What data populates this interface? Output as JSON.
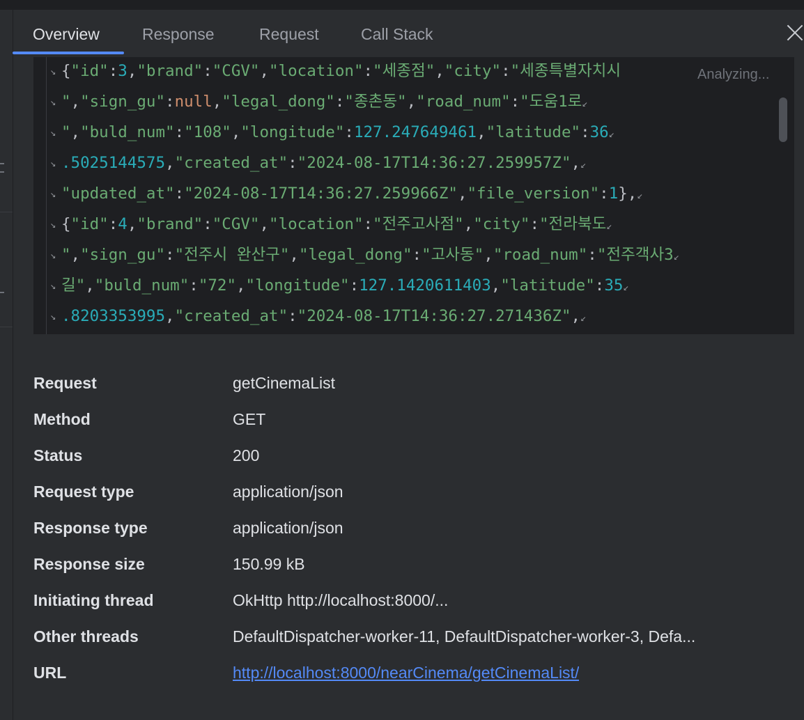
{
  "tabs": [
    {
      "label": "Overview",
      "active": true
    },
    {
      "label": "Response",
      "active": false
    },
    {
      "label": "Request",
      "active": false
    },
    {
      "label": "Call Stack",
      "active": false
    }
  ],
  "status_hint": "Analyzing...",
  "code": {
    "lines": [
      [
        {
          "t": "p",
          "v": "{"
        },
        {
          "t": "s",
          "v": "\"id\""
        },
        {
          "t": "p",
          "v": ":"
        },
        {
          "t": "n",
          "v": "3"
        },
        {
          "t": "p",
          "v": ","
        },
        {
          "t": "s",
          "v": "\"brand\""
        },
        {
          "t": "p",
          "v": ":"
        },
        {
          "t": "s",
          "v": "\"CGV\""
        },
        {
          "t": "p",
          "v": ","
        },
        {
          "t": "s",
          "v": "\"location\""
        },
        {
          "t": "p",
          "v": ":"
        },
        {
          "t": "s",
          "v": "\"세종점\""
        },
        {
          "t": "p",
          "v": ","
        },
        {
          "t": "s",
          "v": "\"city\""
        },
        {
          "t": "p",
          "v": ":"
        },
        {
          "t": "s",
          "v": "\"세종특별자치시"
        }
      ],
      [
        {
          "t": "s",
          "v": "\""
        },
        {
          "t": "p",
          "v": ","
        },
        {
          "t": "s",
          "v": "\"sign_gu\""
        },
        {
          "t": "p",
          "v": ":"
        },
        {
          "t": "k",
          "v": "null"
        },
        {
          "t": "p",
          "v": ","
        },
        {
          "t": "s",
          "v": "\"legal_dong\""
        },
        {
          "t": "p",
          "v": ":"
        },
        {
          "t": "s",
          "v": "\"종촌동\""
        },
        {
          "t": "p",
          "v": ","
        },
        {
          "t": "s",
          "v": "\"road_num\""
        },
        {
          "t": "p",
          "v": ":"
        },
        {
          "t": "s",
          "v": "\"도움1로"
        }
      ],
      [
        {
          "t": "s",
          "v": "\""
        },
        {
          "t": "p",
          "v": ","
        },
        {
          "t": "s",
          "v": "\"buld_num\""
        },
        {
          "t": "p",
          "v": ":"
        },
        {
          "t": "s",
          "v": "\"108\""
        },
        {
          "t": "p",
          "v": ","
        },
        {
          "t": "s",
          "v": "\"longitude\""
        },
        {
          "t": "p",
          "v": ":"
        },
        {
          "t": "n",
          "v": "127.247649461"
        },
        {
          "t": "p",
          "v": ","
        },
        {
          "t": "s",
          "v": "\"latitude\""
        },
        {
          "t": "p",
          "v": ":"
        },
        {
          "t": "n",
          "v": "36"
        }
      ],
      [
        {
          "t": "n",
          "v": ".5025144575"
        },
        {
          "t": "p",
          "v": ","
        },
        {
          "t": "s",
          "v": "\"created_at\""
        },
        {
          "t": "p",
          "v": ":"
        },
        {
          "t": "s",
          "v": "\"2024-08-17T14:36:27.259957Z\""
        },
        {
          "t": "p",
          "v": ","
        }
      ],
      [
        {
          "t": "s",
          "v": "\"updated_at\""
        },
        {
          "t": "p",
          "v": ":"
        },
        {
          "t": "s",
          "v": "\"2024-08-17T14:36:27.259966Z\""
        },
        {
          "t": "p",
          "v": ","
        },
        {
          "t": "s",
          "v": "\"file_version\""
        },
        {
          "t": "p",
          "v": ":"
        },
        {
          "t": "n",
          "v": "1"
        },
        {
          "t": "p",
          "v": "},"
        }
      ],
      [
        {
          "t": "p",
          "v": "{"
        },
        {
          "t": "s",
          "v": "\"id\""
        },
        {
          "t": "p",
          "v": ":"
        },
        {
          "t": "n",
          "v": "4"
        },
        {
          "t": "p",
          "v": ","
        },
        {
          "t": "s",
          "v": "\"brand\""
        },
        {
          "t": "p",
          "v": ":"
        },
        {
          "t": "s",
          "v": "\"CGV\""
        },
        {
          "t": "p",
          "v": ","
        },
        {
          "t": "s",
          "v": "\"location\""
        },
        {
          "t": "p",
          "v": ":"
        },
        {
          "t": "s",
          "v": "\"전주고사점\""
        },
        {
          "t": "p",
          "v": ","
        },
        {
          "t": "s",
          "v": "\"city\""
        },
        {
          "t": "p",
          "v": ":"
        },
        {
          "t": "s",
          "v": "\"전라북도"
        }
      ],
      [
        {
          "t": "s",
          "v": "\""
        },
        {
          "t": "p",
          "v": ","
        },
        {
          "t": "s",
          "v": "\"sign_gu\""
        },
        {
          "t": "p",
          "v": ":"
        },
        {
          "t": "s",
          "v": "\"전주시 완산구\""
        },
        {
          "t": "p",
          "v": ","
        },
        {
          "t": "s",
          "v": "\"legal_dong\""
        },
        {
          "t": "p",
          "v": ":"
        },
        {
          "t": "s",
          "v": "\"고사동\""
        },
        {
          "t": "p",
          "v": ","
        },
        {
          "t": "s",
          "v": "\"road_num\""
        },
        {
          "t": "p",
          "v": ":"
        },
        {
          "t": "s",
          "v": "\"전주객사3"
        }
      ],
      [
        {
          "t": "s",
          "v": "길\""
        },
        {
          "t": "p",
          "v": ","
        },
        {
          "t": "s",
          "v": "\"buld_num\""
        },
        {
          "t": "p",
          "v": ":"
        },
        {
          "t": "s",
          "v": "\"72\""
        },
        {
          "t": "p",
          "v": ","
        },
        {
          "t": "s",
          "v": "\"longitude\""
        },
        {
          "t": "p",
          "v": ":"
        },
        {
          "t": "n",
          "v": "127.1420611403"
        },
        {
          "t": "p",
          "v": ","
        },
        {
          "t": "s",
          "v": "\"latitude\""
        },
        {
          "t": "p",
          "v": ":"
        },
        {
          "t": "n",
          "v": "35"
        }
      ],
      [
        {
          "t": "n",
          "v": ".8203353995"
        },
        {
          "t": "p",
          "v": ","
        },
        {
          "t": "s",
          "v": "\"created_at\""
        },
        {
          "t": "p",
          "v": ":"
        },
        {
          "t": "s",
          "v": "\"2024-08-17T14:36:27.271436Z\""
        },
        {
          "t": "p",
          "v": ","
        }
      ]
    ],
    "colors": {
      "string": "#6aab73",
      "number": "#2aacb8",
      "keyword": "#cf8e6d",
      "punct": "#bcbec4"
    }
  },
  "details": [
    {
      "label": "Request",
      "value": "getCinemaList"
    },
    {
      "label": "Method",
      "value": "GET"
    },
    {
      "label": "Status",
      "value": "200"
    },
    {
      "label": "Request type",
      "value": "application/json"
    },
    {
      "label": "Response type",
      "value": "application/json"
    },
    {
      "label": "Response size",
      "value": "150.99 kB"
    },
    {
      "label": "Initiating thread",
      "value": "OkHttp http://localhost:8000/..."
    },
    {
      "label": "Other threads",
      "value": "DefaultDispatcher-worker-11, DefaultDispatcher-worker-3, Defa..."
    },
    {
      "label": "URL",
      "value": "http://localhost:8000/nearCinema/getCinemaList/",
      "link": true
    }
  ],
  "icons": {
    "wrap": "soft-wrap-icon",
    "close": "close-icon"
  }
}
